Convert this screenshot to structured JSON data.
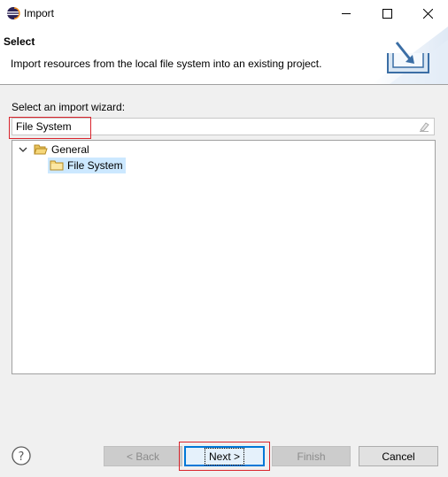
{
  "window": {
    "title": "Import",
    "minimize_icon": "minimize-icon",
    "maximize_icon": "maximize-icon",
    "close_icon": "close-icon"
  },
  "banner": {
    "title": "Select",
    "description": "Import resources from the local file system into an existing project.",
    "graphic_icon": "import-tray-icon"
  },
  "wizard": {
    "label": "Select an import wizard:",
    "filter_value": "File System",
    "clear_icon": "clear-filter-icon"
  },
  "tree": {
    "items": [
      {
        "label": "General",
        "expanded": true,
        "icon": "folder-open-icon"
      },
      {
        "label": "File System",
        "selected": true,
        "icon": "folder-icon"
      }
    ]
  },
  "footer": {
    "help_icon": "help-icon",
    "back_label": "< Back",
    "next_label": "Next >",
    "finish_label": "Finish",
    "cancel_label": "Cancel"
  },
  "colors": {
    "highlight": "#d9242c",
    "default_button_border": "#0078d7",
    "selection": "#cce8ff"
  }
}
